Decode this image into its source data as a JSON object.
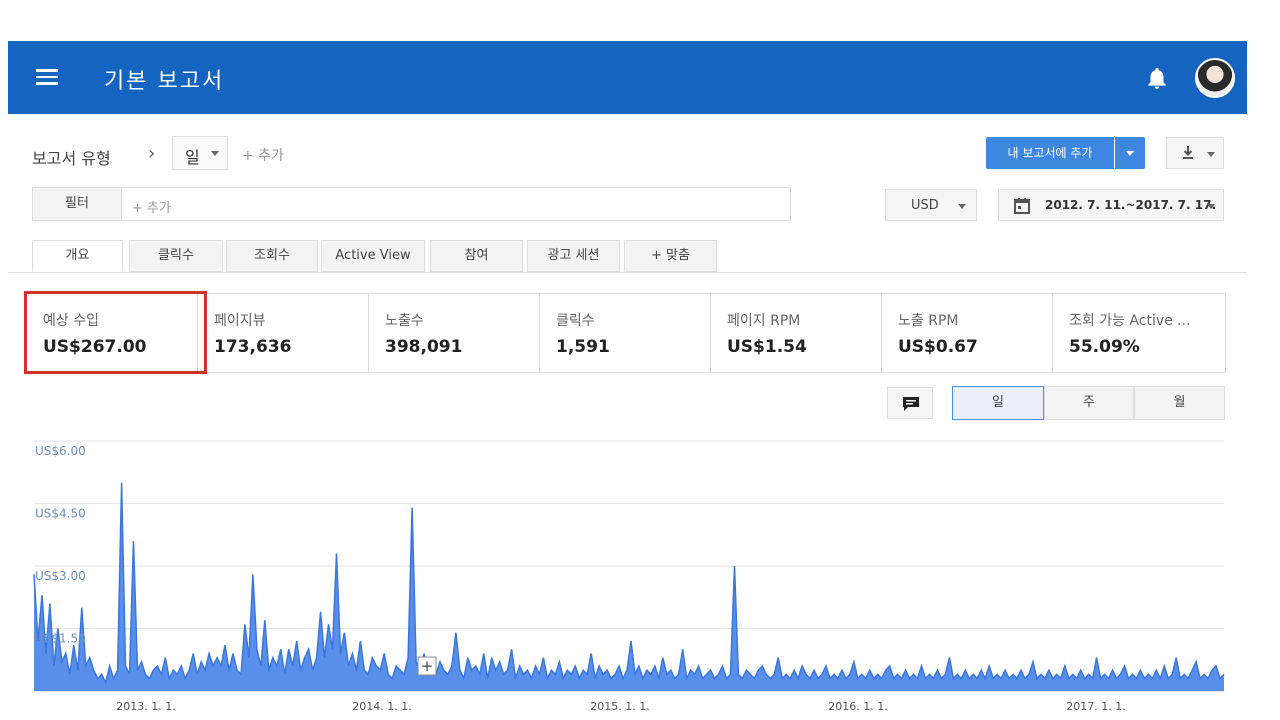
{
  "header": {
    "title": "기본 보고서"
  },
  "toolbar": {
    "report_type_label": "보고서 유형",
    "granularity_value": "일",
    "add_label": "+ 추가",
    "add_to_my_reports": "내 보고서에 추가"
  },
  "filter": {
    "label": "필터",
    "placeholder": "+ 추가"
  },
  "currency": {
    "value": "USD"
  },
  "date_range": {
    "value": "2012. 7. 11.~2017. 7. 17."
  },
  "tabs": [
    {
      "label": "개요",
      "active": true
    },
    {
      "label": "클릭수"
    },
    {
      "label": "조회수"
    },
    {
      "label": "Active View"
    },
    {
      "label": "참여"
    },
    {
      "label": "광고 세션"
    },
    {
      "label": "+ 맞춤"
    }
  ],
  "metrics": [
    {
      "label": "예상 수입",
      "value": "US$267.00",
      "highlighted": true
    },
    {
      "label": "페이지뷰",
      "value": "173,636"
    },
    {
      "label": "노출수",
      "value": "398,091"
    },
    {
      "label": "클릭수",
      "value": "1,591"
    },
    {
      "label": "페이지 RPM",
      "value": "US$1.54"
    },
    {
      "label": "노출 RPM",
      "value": "US$0.67"
    },
    {
      "label": "조회 가능 Active ...",
      "value": "55.09%"
    }
  ],
  "period_buttons": [
    {
      "label": "일",
      "active": true
    },
    {
      "label": "주"
    },
    {
      "label": "월"
    }
  ],
  "colors": {
    "appbar": "#1565c0",
    "primary_button": "#3d87e0",
    "series": "#4a86e8",
    "highlight": "#d32f2f"
  },
  "chart_data": {
    "type": "area",
    "ylim": [
      0,
      6
    ],
    "y_ticks": [
      "US$6.00",
      "US$4.50",
      "US$3.00",
      "US$1.50"
    ],
    "x_ticks": [
      "2013. 1. 1.",
      "2014. 1. 1.",
      "2015. 1. 1.",
      "2016. 1. 1.",
      "2017. 1. 1."
    ],
    "series": [
      {
        "values": [
          2.8,
          1.2,
          2.3,
          0.9,
          2.1,
          0.6,
          1.5,
          0.7,
          0.9,
          0.4,
          1.1,
          0.5,
          2.0,
          0.6,
          0.8,
          0.5,
          0.3,
          0.4,
          0.2,
          0.6,
          0.3,
          0.5,
          5.0,
          0.6,
          0.4,
          3.6,
          0.5,
          0.7,
          0.4,
          0.3,
          0.5,
          0.6,
          0.4,
          0.8,
          0.3,
          0.5,
          0.4,
          0.6,
          0.3,
          0.5,
          0.9,
          0.4,
          0.7,
          0.5,
          0.9,
          0.6,
          0.8,
          0.6,
          1.1,
          0.5,
          0.9,
          0.5,
          0.4,
          1.6,
          0.8,
          2.8,
          1.0,
          0.6,
          1.7,
          0.5,
          0.8,
          0.6,
          1.0,
          0.4,
          1.0,
          0.6,
          1.2,
          0.5,
          0.8,
          1.0,
          0.5,
          0.8,
          1.9,
          0.8,
          1.6,
          1.0,
          3.3,
          0.9,
          1.4,
          0.6,
          0.9,
          0.5,
          1.2,
          0.5,
          0.4,
          0.8,
          0.6,
          0.5,
          0.9,
          0.4,
          0.3,
          0.6,
          0.5,
          0.4,
          0.8,
          4.4,
          0.7,
          0.5,
          0.9,
          0.4,
          0.6,
          0.4,
          0.7,
          0.5,
          0.4,
          0.6,
          1.4,
          0.5,
          0.3,
          0.8,
          0.5,
          0.6,
          0.4,
          0.9,
          0.3,
          0.8,
          0.5,
          0.7,
          0.4,
          0.5,
          1.0,
          0.3,
          0.6,
          0.4,
          0.5,
          0.3,
          0.6,
          0.4,
          0.8,
          0.3,
          0.5,
          0.4,
          0.7,
          0.3,
          0.5,
          0.4,
          0.6,
          0.3,
          0.5,
          0.4,
          0.9,
          0.3,
          0.6,
          0.4,
          0.5,
          0.3,
          0.4,
          0.6,
          0.3,
          0.5,
          1.2,
          0.4,
          0.6,
          0.3,
          0.5,
          0.4,
          0.6,
          0.3,
          0.8,
          0.4,
          0.5,
          0.3,
          0.4,
          1.0,
          0.3,
          0.5,
          0.4,
          0.6,
          0.3,
          0.4,
          0.5,
          0.3,
          0.4,
          0.6,
          0.3,
          0.4,
          3.0,
          0.4,
          0.3,
          0.5,
          0.4,
          0.3,
          0.5,
          0.6,
          0.4,
          0.3,
          0.4,
          0.8,
          0.3,
          0.4,
          0.3,
          0.5,
          0.3,
          0.6,
          0.4,
          0.3,
          0.5,
          0.3,
          0.4,
          0.6,
          0.3,
          0.4,
          0.3,
          0.5,
          0.3,
          0.4,
          0.7,
          0.3,
          0.4,
          0.3,
          0.5,
          0.3,
          0.4,
          0.3,
          0.5,
          0.6,
          0.3,
          0.4,
          0.3,
          0.5,
          0.3,
          0.4,
          0.3,
          0.6,
          0.3,
          0.4,
          0.3,
          0.5,
          0.3,
          0.4,
          0.8,
          0.3,
          0.4,
          0.3,
          0.5,
          0.3,
          0.4,
          0.3,
          0.5,
          0.3,
          0.6,
          0.3,
          0.4,
          0.3,
          0.5,
          0.3,
          0.4,
          0.3,
          0.5,
          0.3,
          0.4,
          0.7,
          0.3,
          0.4,
          0.3,
          0.5,
          0.3,
          0.4,
          0.3,
          0.6,
          0.3,
          0.4,
          0.3,
          0.5,
          0.3,
          0.4,
          0.3,
          0.8,
          0.3,
          0.4,
          0.3,
          0.5,
          0.3,
          0.4,
          0.6,
          0.3,
          0.4,
          0.3,
          0.5,
          0.3,
          0.4,
          0.3,
          0.5,
          0.3,
          0.6,
          0.3,
          0.4,
          0.8,
          0.3,
          0.4,
          0.3,
          0.5,
          0.7,
          0.3,
          0.4,
          0.3,
          0.5,
          0.6,
          0.3,
          0.4
        ]
      }
    ]
  }
}
